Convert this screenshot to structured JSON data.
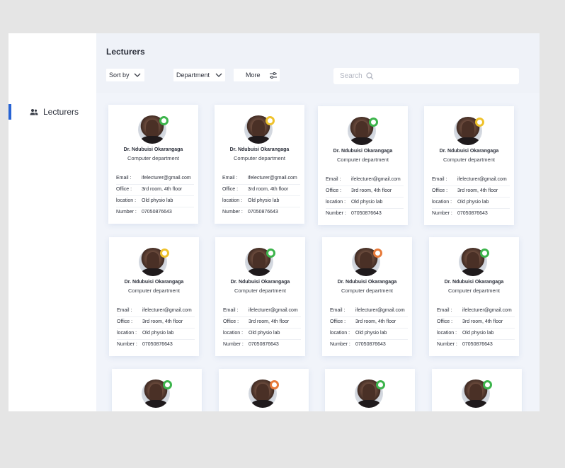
{
  "sidebar": {
    "items": [
      {
        "label": "Lecturers",
        "icon": "users-icon",
        "active": true
      }
    ]
  },
  "header": {
    "title": "Lecturers",
    "sort_label": "Sort by",
    "department_label": "Department",
    "more_label": "More",
    "search_placeholder": "Search"
  },
  "colors": {
    "accent": "#2864d4",
    "online": "#3cb44b",
    "away": "#efc22c",
    "busy": "#e77a3a"
  },
  "labels": {
    "email": "Email :",
    "office": "Office :",
    "location": "location :",
    "number": "Number :"
  },
  "cards": [
    {
      "name": "Dr. Ndubuisi Okarangaga",
      "department": "Computer department",
      "email": "ifelecturer@gmail.com",
      "office": "3rd room, 4th floor",
      "location": "Old physio lab",
      "number": "07050876643",
      "status": "green"
    },
    {
      "name": "Dr. Ndubuisi Okarangaga",
      "department": "Computer department",
      "email": "ifelecturer@gmail.com",
      "office": "3rd room, 4th floor",
      "location": "Old physio lab",
      "number": "07050876643",
      "status": "yellow"
    },
    {
      "name": "Dr. Ndubuisi Okarangaga",
      "department": "Computer department",
      "email": "ifelecturer@gmail.com",
      "office": "3rd room, 4th floor",
      "location": "Old physio lab",
      "number": "07050876643",
      "status": "green"
    },
    {
      "name": "Dr. Ndubuisi Okarangaga",
      "department": "Computer department",
      "email": "ifelecturer@gmail.com",
      "office": "3rd room, 4th floor",
      "location": "Old physio lab",
      "number": "07050876643",
      "status": "yellow"
    },
    {
      "name": "Dr. Ndubuisi Okarangaga",
      "department": "Computer department",
      "email": "ifelecturer@gmail.com",
      "office": "3rd room, 4th floor",
      "location": "Old physio lab",
      "number": "07050876643",
      "status": "yellow"
    },
    {
      "name": "Dr. Ndubuisi Okarangaga",
      "department": "Computer department",
      "email": "ifelecturer@gmail.com",
      "office": "3rd room, 4th floor",
      "location": "Old physio lab",
      "number": "07050876643",
      "status": "green"
    },
    {
      "name": "Dr. Ndubuisi Okarangaga",
      "department": "Computer department",
      "email": "ifelecturer@gmail.com",
      "office": "3rd room, 4th floor",
      "location": "Old physio lab",
      "number": "07050876643",
      "status": "orange"
    },
    {
      "name": "Dr. Ndubuisi Okarangaga",
      "department": "Computer department",
      "email": "ifelecturer@gmail.com",
      "office": "3rd room, 4th floor",
      "location": "Old physio lab",
      "number": "07050876643",
      "status": "green"
    },
    {
      "status": "green"
    },
    {
      "status": "orange"
    },
    {
      "status": "green"
    },
    {
      "status": "green"
    }
  ]
}
